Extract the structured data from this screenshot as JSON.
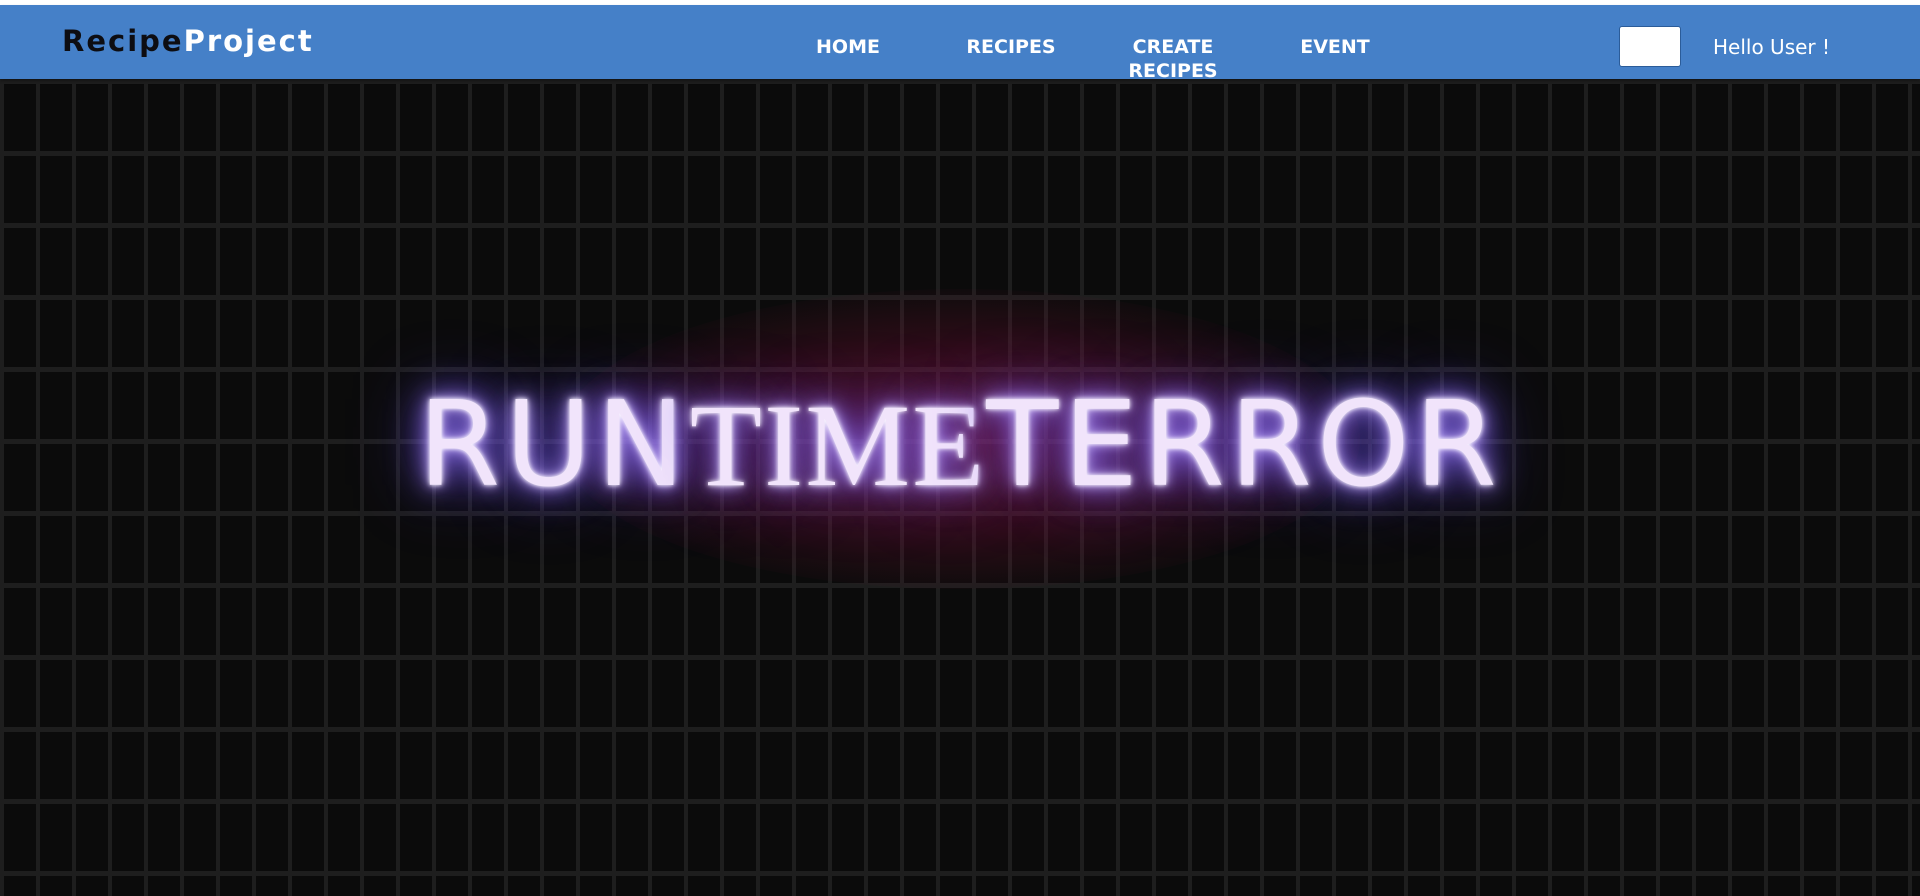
{
  "navbar": {
    "brand_part1": "Recipe",
    "brand_part2": "Project",
    "links": {
      "home": "HOME",
      "recipes": "RECIPES",
      "create_line1": "CREATE",
      "create_line2": "RECIPES",
      "event": "EVENT"
    },
    "greeting": "Hello User !"
  },
  "hero": {
    "neon_part1": "RUN",
    "neon_part2": "TIME",
    "neon_part3": "TERROR"
  },
  "colors": {
    "navbar": "#4580c8",
    "brand_dark": "#0d0d12",
    "hero_background": "#0b0b0b",
    "neon_text": "#f1e4fb",
    "neon_glow": "#7b5cff",
    "backglow": "#96143c"
  }
}
